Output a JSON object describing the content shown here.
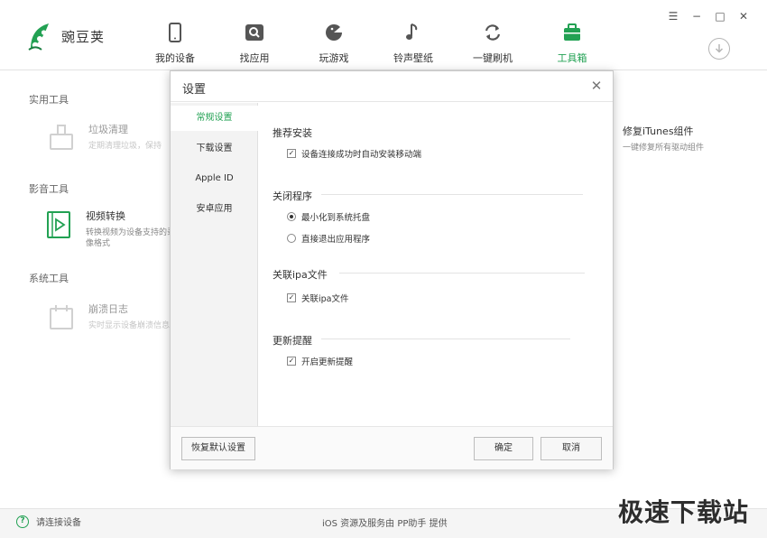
{
  "app": {
    "logo_text": "豌豆荚"
  },
  "nav": [
    {
      "label": "我的设备",
      "icon": "phone-icon"
    },
    {
      "label": "找应用",
      "icon": "app-search-icon"
    },
    {
      "label": "玩游戏",
      "icon": "game-icon"
    },
    {
      "label": "铃声壁纸",
      "icon": "music-icon"
    },
    {
      "label": "一键刷机",
      "icon": "refresh-icon"
    },
    {
      "label": "工具箱",
      "icon": "toolbox-icon",
      "active": true
    }
  ],
  "window_controls": {
    "menu": "☰",
    "minimize": "−",
    "maximize": "□",
    "close": "✕"
  },
  "tools": {
    "sections": [
      {
        "title": "实用工具"
      },
      {
        "title": "影音工具"
      },
      {
        "title": "系统工具"
      }
    ],
    "items": [
      {
        "name": "垃圾清理",
        "desc": "定期清理垃圾，保持"
      },
      {
        "name": "视频转换",
        "desc": "转换视频为设备支持的录像格式"
      },
      {
        "name": "崩溃日志",
        "desc": "实时显示设备崩溃信息"
      },
      {
        "name": "修复iTunes组件",
        "desc": "一键修复所有驱动组件"
      }
    ]
  },
  "dialog": {
    "title": "设置",
    "close": "✕",
    "side": [
      {
        "label": "常规设置",
        "active": true
      },
      {
        "label": "下载设置"
      },
      {
        "label": "Apple ID"
      },
      {
        "label": "安卓应用"
      }
    ],
    "groups": [
      {
        "title": "推荐安装",
        "options": [
          {
            "label": "设备连接成功时自动安装移动端",
            "type": "checkbox",
            "checked": true
          }
        ]
      },
      {
        "title": "关闭程序",
        "options": [
          {
            "label": "最小化到系统托盘",
            "type": "radio",
            "checked": true
          },
          {
            "label": "直接退出应用程序",
            "type": "radio",
            "checked": false
          }
        ]
      },
      {
        "title": "关联ipa文件",
        "options": [
          {
            "label": "关联ipa文件",
            "type": "checkbox",
            "checked": true
          }
        ]
      },
      {
        "title": "更新提醒",
        "options": [
          {
            "label": "开启更新提醒",
            "type": "checkbox",
            "checked": true
          }
        ]
      }
    ],
    "footer": {
      "restore": "恢复默认设置",
      "ok": "确定",
      "cancel": "取消"
    }
  },
  "status": {
    "connect_text": "请连接设备",
    "credit": "iOS 资源及服务由 PP助手 提供"
  },
  "watermark": "极速下载站",
  "colors": {
    "accent": "#22a153"
  }
}
